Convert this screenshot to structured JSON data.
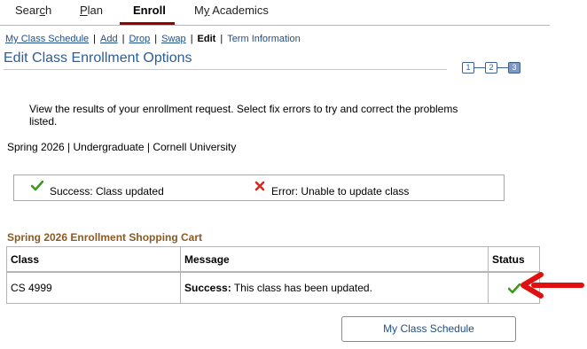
{
  "tabs": [
    {
      "label_pre": "Sear",
      "label_u": "c",
      "label_post": "h"
    },
    {
      "label_pre": "",
      "label_u": "P",
      "label_post": "lan"
    },
    {
      "label_pre": "Enroll",
      "label_u": "",
      "label_post": ""
    },
    {
      "label_pre": "M",
      "label_u": "y",
      "label_post": " Academics"
    }
  ],
  "sublinks": {
    "schedule": "My Class Schedule",
    "add": "Add",
    "drop": "Drop",
    "swap": "Swap",
    "edit": "Edit",
    "term_info": "Term Information",
    "separator": "|"
  },
  "page_title": "Edit Class Enrollment Options",
  "steps": [
    "1",
    "2",
    "3"
  ],
  "instructions": "View the results of your enrollment request.  Select fix errors to try and correct the problems listed.",
  "term_line": "Spring 2026 | Undergraduate | Cornell University",
  "messages": {
    "success": "Success:  Class updated",
    "error": "Error: Unable to update class"
  },
  "cart": {
    "title": "Spring 2026 Enrollment Shopping Cart",
    "headers": {
      "class": "Class",
      "message": "Message",
      "status": "Status"
    },
    "rows": [
      {
        "class": "CS 4999",
        "message_bold": "Success:",
        "message_rest": " This class has been updated."
      }
    ]
  },
  "button_label": "My Class Schedule",
  "colors": {
    "accent_link": "#1f4f8a",
    "title": "#2a5d9c",
    "success": "#3d9a1e",
    "error": "#d62b1f",
    "annotation_arrow": "#e01010"
  },
  "icons": {
    "success": "check-icon",
    "error": "x-icon",
    "annotation": "red-arrow-icon"
  }
}
